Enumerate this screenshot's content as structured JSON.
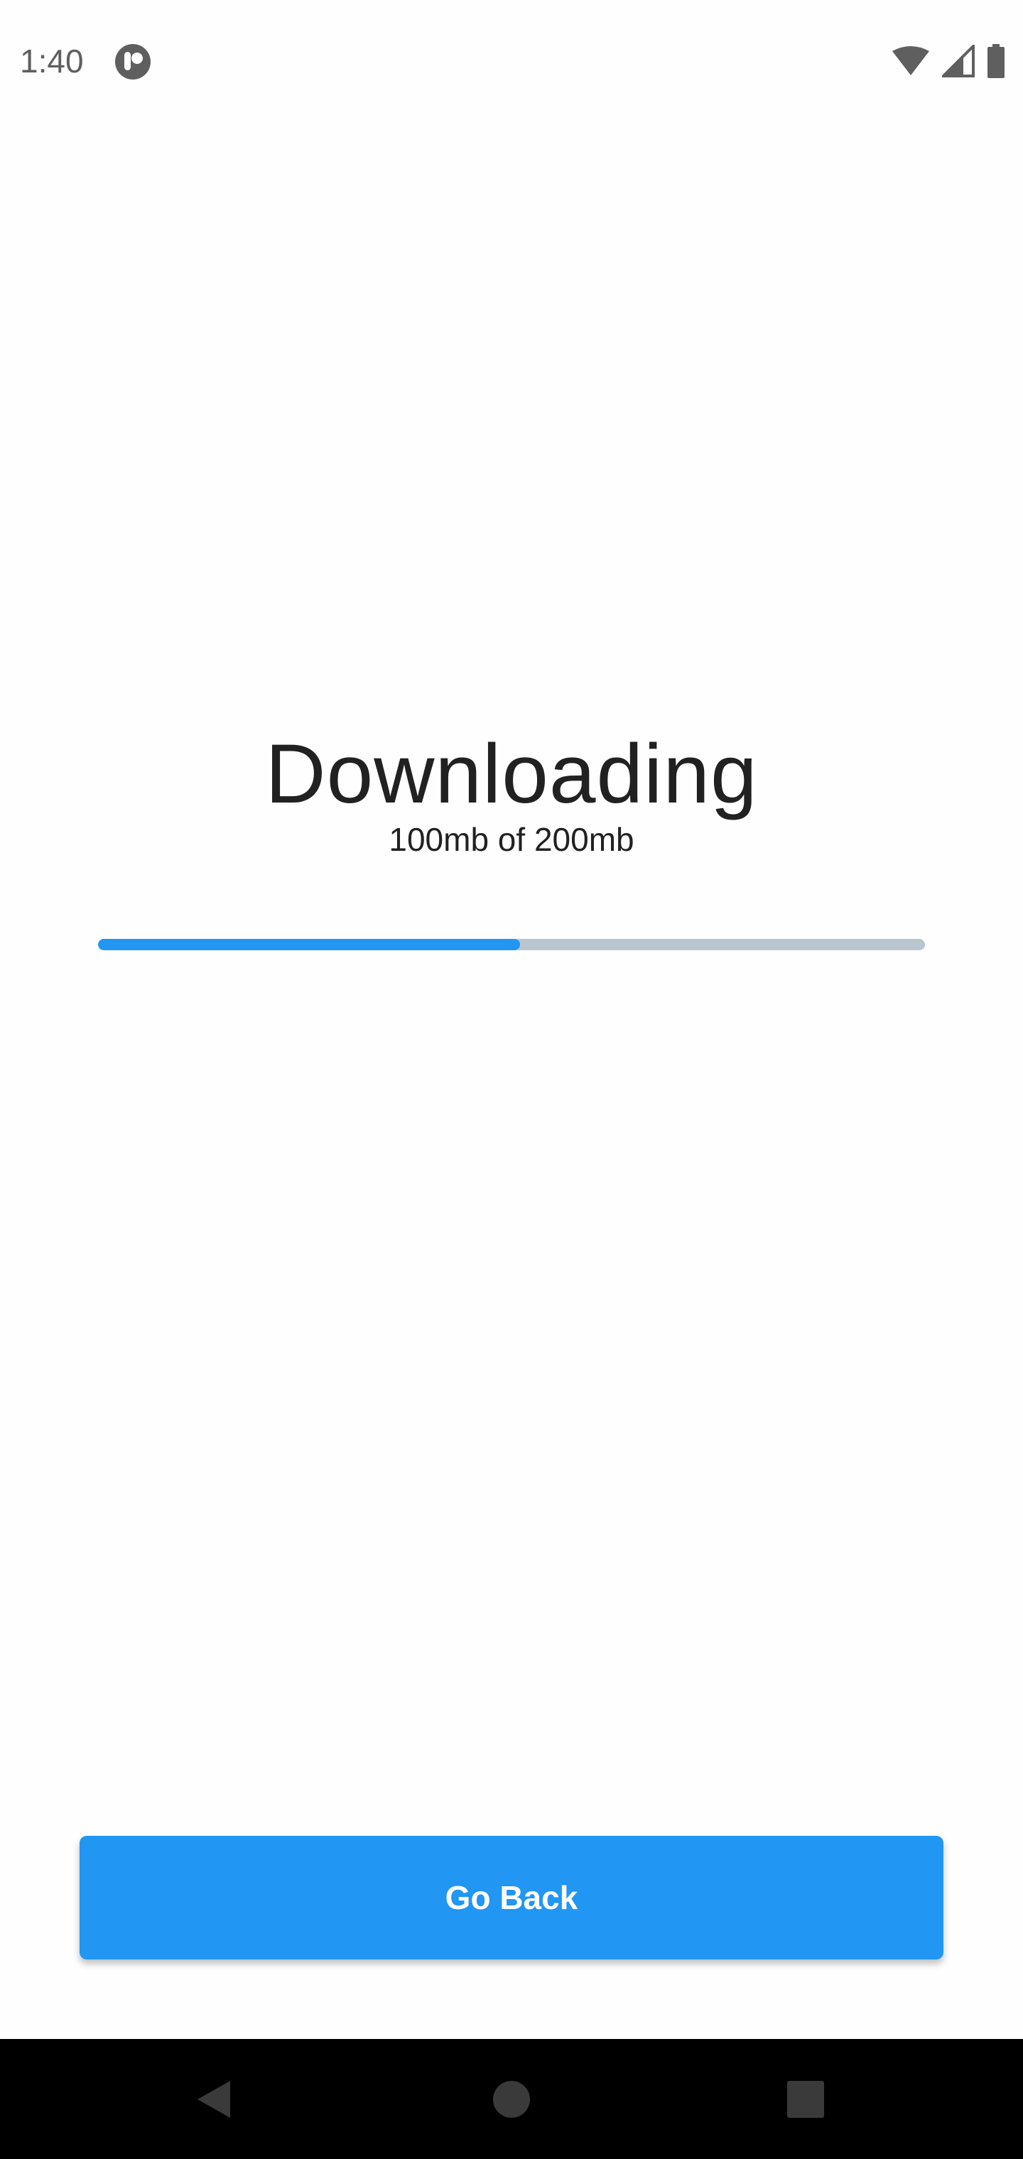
{
  "status_bar": {
    "time": "1:40",
    "icons": [
      "app-notification-icon",
      "wifi-icon",
      "cellular-signal-icon",
      "battery-icon"
    ]
  },
  "download": {
    "title": "Downloading",
    "progress_text": "100mb of 200mb",
    "progress_fraction": 0.51,
    "colors": {
      "accent": "#2196f3",
      "track": "#b9c6cf",
      "text": "#212121"
    }
  },
  "actions": {
    "go_back_label": "Go Back"
  },
  "nav_bar": {
    "icons": [
      "back-icon",
      "home-icon",
      "recents-icon"
    ]
  }
}
